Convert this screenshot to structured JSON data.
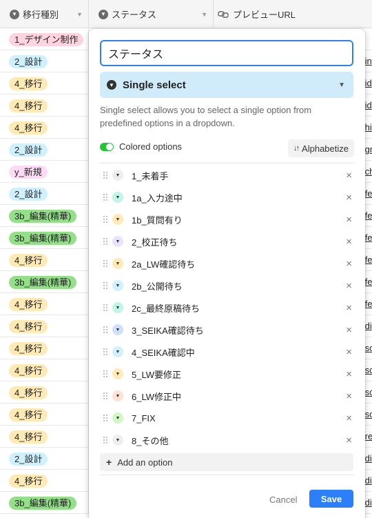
{
  "grid": {
    "columns": [
      {
        "name": "移行種別",
        "icon": "single-select-icon"
      },
      {
        "name": "ステータス",
        "icon": "single-select-icon"
      },
      {
        "name": "プレビューURL",
        "icon": "link-icon"
      }
    ],
    "rows": [
      {
        "tag": "1_デザイン制作",
        "color": "#ffd4e0",
        "url": ""
      },
      {
        "tag": "2_設計",
        "color": "#d0f0fd",
        "url": "/in"
      },
      {
        "tag": "4_移行",
        "color": "#ffeab6",
        "url": "/id"
      },
      {
        "tag": "4_移行",
        "color": "#ffeab6",
        "url": "/id"
      },
      {
        "tag": "4_移行",
        "color": "#ffeab6",
        "url": "/hi"
      },
      {
        "tag": "2_設計",
        "color": "#d0f0fd",
        "url": "/gr"
      },
      {
        "tag": "y_新規",
        "color": "#ffdaf6",
        "url": "/ch"
      },
      {
        "tag": "2_設計",
        "color": "#d0f0fd",
        "url": "/fe"
      },
      {
        "tag": "3b_編集(精華)",
        "color": "#93e088",
        "url": "/fe"
      },
      {
        "tag": "3b_編集(精華)",
        "color": "#93e088",
        "url": "/fe"
      },
      {
        "tag": "4_移行",
        "color": "#ffeab6",
        "url": "/fe"
      },
      {
        "tag": "3b_編集(精華)",
        "color": "#93e088",
        "url": "/fe"
      },
      {
        "tag": "4_移行",
        "color": "#ffeab6",
        "url": "/fe"
      },
      {
        "tag": "4_移行",
        "color": "#ffeab6",
        "url": "/di"
      },
      {
        "tag": "4_移行",
        "color": "#ffeab6",
        "url": "/sc"
      },
      {
        "tag": "4_移行",
        "color": "#ffeab6",
        "url": "/sc"
      },
      {
        "tag": "4_移行",
        "color": "#ffeab6",
        "url": "/sc"
      },
      {
        "tag": "4_移行",
        "color": "#ffeab6",
        "url": "/sc"
      },
      {
        "tag": "4_移行",
        "color": "#ffeab6",
        "url": "/re"
      },
      {
        "tag": "2_設計",
        "color": "#d0f0fd",
        "url": "/di"
      },
      {
        "tag": "4_移行",
        "color": "#ffeab6",
        "url": "/di"
      },
      {
        "tag": "3b_編集(精華)",
        "color": "#93e088",
        "url": "/di"
      }
    ]
  },
  "dialog": {
    "field_name": "ステータス",
    "field_type": "Single select",
    "field_type_icon": "single-select-icon",
    "description": "Single select allows you to select a single option from predefined options in a dropdown.",
    "colored_options_label": "Colored options",
    "colored_options_on": true,
    "alphabetize_label": "Alphabetize",
    "options": [
      {
        "label": "1_未着手",
        "color": "#eeeeee"
      },
      {
        "label": "1a_入力途中",
        "color": "#c2f5e9"
      },
      {
        "label": "1b_質問有り",
        "color": "#ffeab6"
      },
      {
        "label": "2_校正待ち",
        "color": "#ede2fe"
      },
      {
        "label": "2a_LW確認待ち",
        "color": "#ffeab6"
      },
      {
        "label": "2b_公開待ち",
        "color": "#d0f0fd"
      },
      {
        "label": "2c_最終原稿待ち",
        "color": "#c2f5e9"
      },
      {
        "label": "3_SEIKA確認待ち",
        "color": "#cfdfff"
      },
      {
        "label": "4_SEIKA確認中",
        "color": "#d0f0fd"
      },
      {
        "label": "5_LW要修正",
        "color": "#ffeab6"
      },
      {
        "label": "6_LW修正中",
        "color": "#fee2d5"
      },
      {
        "label": "7_FIX",
        "color": "#d1f7c4"
      },
      {
        "label": "8_その他",
        "color": "#eeeeee"
      }
    ],
    "add_option_label": "Add an option",
    "cancel_label": "Cancel",
    "save_label": "Save"
  }
}
